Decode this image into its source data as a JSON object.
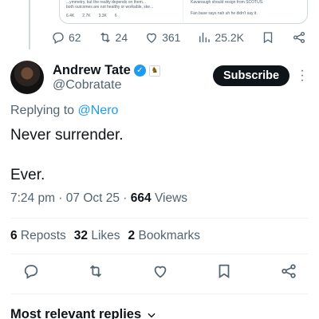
{
  "quoted_preview": {
    "left_lines": [
      "...ymmetry, but the reality depends on them...",
      "both outcomes are not healthy or workable, ske..."
    ],
    "left_stats": [
      "6.4K",
      "2.7K",
      "3.3K",
      "6"
    ],
    "right_lines": [
      "Kavanaugh should resign from SCOTUS.",
      "Fan base says nah uh he didn't say it."
    ]
  },
  "parent_actions": {
    "replies": "62",
    "reposts": "24",
    "likes": "361",
    "views": "25.2K"
  },
  "author": {
    "name": "Andrew Tate",
    "handle": "@Cobratate",
    "subscribe_label": "Subscribe"
  },
  "tweet": {
    "replying_prefix": "Replying to",
    "replying_to": "@Nero",
    "line1": "Never surrender.",
    "line2": "Ever.",
    "timestamp": "7:24 pm · 07 Oct 25 · ",
    "views_count": "664",
    "views_label": " Views"
  },
  "stats": {
    "reposts_count": "6",
    "reposts_label": " Reposts",
    "likes_count": "32",
    "likes_label": " Likes",
    "bookmarks_count": "2",
    "bookmarks_label": " Bookmarks"
  },
  "replies_sort": {
    "label": "Most relevant replies"
  },
  "colors": {
    "accent": "#1d9bf0",
    "text_primary": "#0f1419",
    "text_secondary": "#536471",
    "divider": "#eff3f4"
  },
  "icons": [
    "reply-icon",
    "repost-icon",
    "like-icon",
    "views-icon",
    "bookmark-icon",
    "share-icon",
    "verified-badge-icon",
    "affiliate-badge-icon",
    "more-icon",
    "chevron-down-icon"
  ]
}
